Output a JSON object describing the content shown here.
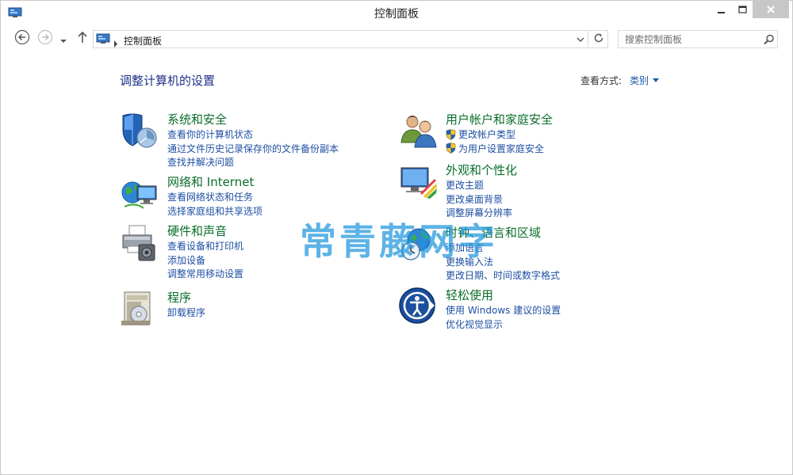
{
  "window": {
    "title": "控制面板",
    "icon": "control-panel-icon"
  },
  "toolbar": {
    "back_icon": "back-arrow-icon",
    "forward_icon": "forward-arrow-icon",
    "recent_icon": "chevron-down-icon",
    "up_icon": "up-arrow-icon",
    "address_text": "控制面板",
    "refresh_icon": "refresh-icon",
    "search_placeholder": "搜索控制面板"
  },
  "content": {
    "page_title": "调整计算机的设置",
    "view_by_label": "查看方式:",
    "view_by_value": "类别"
  },
  "categories": {
    "system": {
      "title": "系统和安全",
      "icon": "shield-icon",
      "links": [
        "查看你的计算机状态",
        "通过文件历史记录保存你的文件备份副本",
        "查找并解决问题"
      ]
    },
    "network": {
      "title": "网络和 Internet",
      "icon": "globe-network-icon",
      "links": [
        "查看网络状态和任务",
        "选择家庭组和共享选项"
      ]
    },
    "hardware": {
      "title": "硬件和声音",
      "icon": "printer-icon",
      "links": [
        "查看设备和打印机",
        "添加设备",
        "调整常用移动设置"
      ]
    },
    "programs": {
      "title": "程序",
      "icon": "programs-icon",
      "links": [
        "卸载程序"
      ]
    },
    "users": {
      "title": "用户帐户和家庭安全",
      "icon": "users-icon",
      "links": [
        "更改帐户类型",
        "为用户设置家庭安全"
      ]
    },
    "appearance": {
      "title": "外观和个性化",
      "icon": "appearance-icon",
      "links": [
        "更改主题",
        "更改桌面背景",
        "调整屏幕分辨率"
      ]
    },
    "clock": {
      "title": "时钟、语言和区域",
      "icon": "clock-globe-icon",
      "links": [
        "添加语言",
        "更换输入法",
        "更改日期、时间或数字格式"
      ]
    },
    "ease": {
      "title": "轻松使用",
      "icon": "ease-of-access-icon",
      "links": [
        "使用 Windows 建议的设置",
        "优化视觉显示"
      ]
    }
  },
  "watermark": "常青藤网字",
  "colors": {
    "category_title": "#0b6e2b",
    "link": "#1e4fa3",
    "page_title": "#1e3287",
    "close_button": "#c7c7c7"
  }
}
